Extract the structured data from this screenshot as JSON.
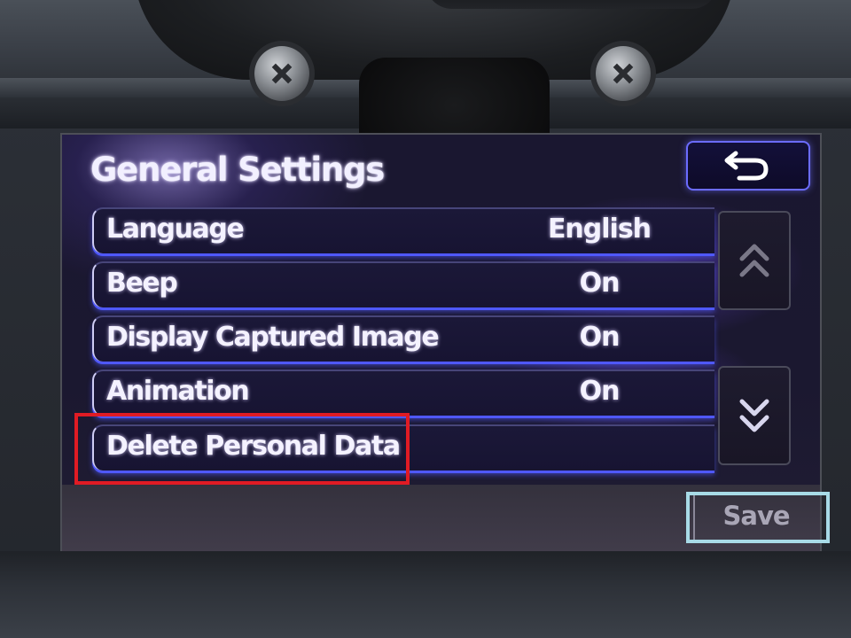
{
  "page_title": "General Settings",
  "icons": {
    "back": "back-arrow-icon",
    "scroll_up": "double-chevron-up-icon",
    "scroll_down": "double-chevron-down-icon"
  },
  "settings": [
    {
      "label": "Language",
      "value": "English"
    },
    {
      "label": "Beep",
      "value": "On"
    },
    {
      "label": "Display Captured Image",
      "value": "On"
    },
    {
      "label": "Animation",
      "value": "On"
    },
    {
      "label": "Delete Personal Data",
      "value": ""
    }
  ],
  "save_label": "Save",
  "colors": {
    "row_glow": "#4f58ff",
    "highlight_red": "#e01b24",
    "highlight_cyan": "#a8dbe7"
  }
}
